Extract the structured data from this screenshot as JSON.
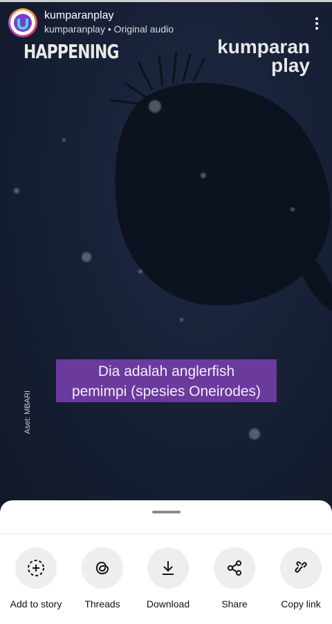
{
  "post": {
    "account_name": "kumparanplay",
    "audio_line": "kumparanplay • Original audio",
    "overlay_happening": "HAPPENING",
    "brand_line1": "kumparan",
    "brand_line2": "play",
    "caption_line1": "Dia adalah anglerfish",
    "caption_line2": "pemimpi (spesies Oneirodes)",
    "asset_credit": "Aset: MBARI"
  },
  "share_sheet": {
    "actions": [
      {
        "label": "Add to story",
        "icon": "add-story-icon"
      },
      {
        "label": "Threads",
        "icon": "threads-icon"
      },
      {
        "label": "Download",
        "icon": "download-icon"
      },
      {
        "label": "Share",
        "icon": "share-icon"
      },
      {
        "label": "Copy link",
        "icon": "link-icon"
      }
    ]
  },
  "colors": {
    "caption_bg": "#6b3a9d",
    "sheet_bg": "#ffffff",
    "action_circle": "#eeeeee"
  }
}
